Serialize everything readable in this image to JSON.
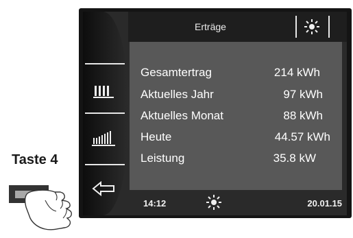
{
  "header": {
    "title": "Erträge",
    "right_icon": "sun-icon"
  },
  "sidebar": {
    "items": [
      {
        "icon": "bar-chart-icon"
      },
      {
        "icon": "bar-chart-fine-icon"
      },
      {
        "icon": "arrow-left-icon"
      }
    ]
  },
  "yields": [
    {
      "label": "Gesamtertrag",
      "value": "214 kWh"
    },
    {
      "label": "Aktuelles Jahr",
      "value": "97 kWh"
    },
    {
      "label": "Aktuelles Monat",
      "value": "88 kWh"
    },
    {
      "label": "Heute",
      "value": "44.57 kWh"
    },
    {
      "label": "Leistung",
      "value": "35.8 kW"
    }
  ],
  "footer": {
    "time": "14:12",
    "status_icon": "sun-icon",
    "date": "20.01.15"
  },
  "annotation": {
    "key_label": "Taste 4"
  },
  "colors": {
    "device": "#141414",
    "screen": "#2a2a2a",
    "content": "#585858",
    "text": "#ffffff"
  }
}
